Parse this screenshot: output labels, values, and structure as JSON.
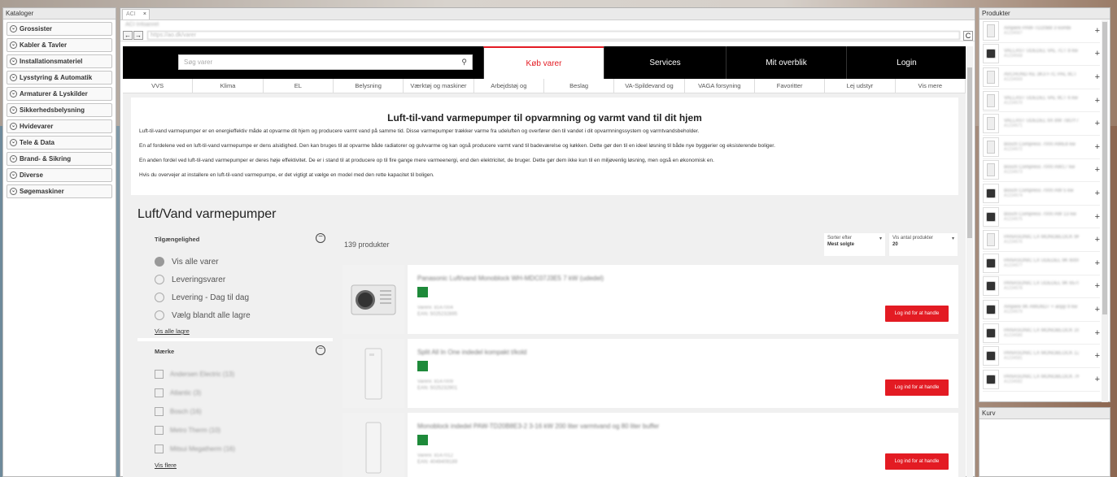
{
  "left_panel": {
    "title": "Kataloger",
    "categories": [
      "Grossister",
      "Kabler & Tavler",
      "Installationsmateriel",
      "Lysstyring & Automatik",
      "Armaturer & Lyskilder",
      "Sikkerhedsbelysning",
      "Hvidevarer",
      "Tele & Data",
      "Brand- & Sikring",
      "Diverse",
      "Søgemaskiner"
    ]
  },
  "browser": {
    "tab_label": "ACI",
    "tab_close": "×",
    "page_title": "ACI Infoanret",
    "url": "https://ao.dk/varer",
    "back": "←",
    "forward": "→",
    "refresh": "C"
  },
  "site": {
    "search_placeholder": "Søg varer",
    "search_icon": "magnifier-icon",
    "top_tabs": [
      "Køb varer",
      "Services",
      "Mit overblik",
      "Login"
    ],
    "subnav": [
      "VVS",
      "Klima",
      "EL",
      "Belysning",
      "Værktøj og maskiner",
      "Arbejdstøj og",
      "Beslag",
      "VA-Spildevand og",
      "VAGA forsyning",
      "Favoritter",
      "Lej udstyr",
      "Vis mere"
    ],
    "intro": {
      "heading": "Luft-til-vand varmepumper til opvarmning og varmt vand til dit hjem",
      "paragraphs": [
        "Luft-til-vand varmepumper er en energieffektiv måde at opvarme dit hjem og producere varmt vand på samme tid. Disse varmepumper trækker varme fra udeluften og overfører den til vandet i dit opvarmningssystem og varmtvandsbeholder.",
        "En af fordelene ved en luft-til-vand varmepumpe er dens alsidighed. Den kan bruges til at opvarme både radiatorer og gulvvarme og kan også producere varmt vand til badeværelse og køkken. Dette gør den til en ideel løsning til både nye byggerier og eksisterende boliger.",
        "En anden fordel ved luft-til-vand varmepumper er deres høje effektivitet. De er i stand til at producere op til fire gange mere varmeenergi, end den elektricitet, de bruger. Dette gør dem ikke kun til en miljøvenlig løsning, men også en økonomisk en.",
        "Hvis du overvejer at installere en luft-til-vand varmepumpe, er det vigtigt at vælge en model med den rette kapacitet til boligen."
      ]
    },
    "category_heading": "Luft/Vand varmepumper",
    "filters": {
      "availability_title": "Tilgængelighed",
      "availability_options": [
        "Vis alle varer",
        "Leveringsvarer",
        "Levering - Dag til dag",
        "Vælg blandt alle lagre"
      ],
      "all_stores_link": "Vis alle lagre",
      "brand_title": "Mærke",
      "brands": [
        "Andersen Electric (13)",
        "Atlantic (3)",
        "Bosch (16)",
        "Metro Therm (10)",
        "Mitsui Megatherm (16)"
      ],
      "more_link": "Vis flere",
      "collapse_symbol": "−"
    },
    "results": {
      "count": "139 produkter",
      "sort_label": "Sorter efter",
      "sort_value": "Mest solgte",
      "perpage_label": "Vis antal produkter",
      "perpage_value": "20",
      "dropdown_arrow": "▾",
      "login_button": "Log ind for at handle",
      "products": [
        {
          "title": "Panasonic Luft/vand Monoblock WH-MDC07J3E5 7 kW (udedel)",
          "meta1": "Varenr. 8147004",
          "meta2": "EAN: 5025232895"
        },
        {
          "title": "Split All In One indedel kompakt t/kold",
          "meta1": "Varenr. 8147009",
          "meta2": "EAN: 5025232901"
        },
        {
          "title": "Monoblock indedel PAW-TD20B8E3-2 3-16 kW 200 liter varmtvand og 80 liter buffer",
          "meta1": "Varenr. 8147012",
          "meta2": "EAN: 4049409189"
        }
      ]
    }
  },
  "products_panel": {
    "title": "Produkter",
    "add_symbol": "+",
    "items": [
      {
        "name": "Ampere PAW-TD20B8 3 kombi",
        "sub": "A1234567"
      },
      {
        "name": "VALLAST UDEDEL VAL 7CT 8 kw",
        "sub": "A1234568"
      },
      {
        "name": "AVCHUND KE 3K3 F7C PAL 9CT",
        "sub": "A1234569"
      },
      {
        "name": "VALLAST UDEDEL VAL 9CT 6 kw",
        "sub": "A1234570"
      },
      {
        "name": "VALLAST UDEDEL 9X 8W 7BUY7",
        "sub": "A1234571"
      },
      {
        "name": "Bosch Compress 7000 AWE8 kw",
        "sub": "A1234572"
      },
      {
        "name": "Bosch Compress 7000 AW17 kw",
        "sub": "A1234573"
      },
      {
        "name": "Bosch Compress 7000 AW 5 kw",
        "sub": "A1234574"
      },
      {
        "name": "Bosch Compress 7000 AW 13 kw",
        "sub": "A1234575"
      },
      {
        "name": "PANASONIC LX MONOBLOCK 9K",
        "sub": "A1234576"
      },
      {
        "name": "PANASONIC LX UDEDEL 9K 6000",
        "sub": "A1234577"
      },
      {
        "name": "PANASONIC LX UDEDEL 9K 6570",
        "sub": "A1234578"
      },
      {
        "name": "Ampere 9K AWD6D7 + anpp 9 kw",
        "sub": "A1234579"
      },
      {
        "name": "PANASONIC LX MONOBLOCK 16K",
        "sub": "A1234580"
      },
      {
        "name": "PANASONIC LX MONOBLOCK 12K",
        "sub": "A1234581"
      },
      {
        "name": "PANASONIC LX MONOBLOCK 7K",
        "sub": "A1234582"
      }
    ]
  },
  "cart_panel": {
    "title": "Kurv"
  }
}
